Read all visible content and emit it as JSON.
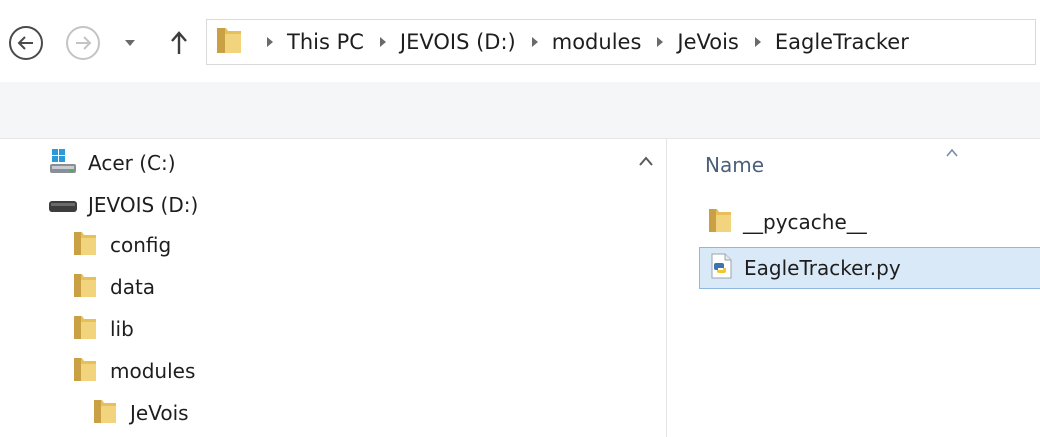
{
  "address_bar": {
    "path": [
      "This PC",
      "JEVOIS (D:)",
      "modules",
      "JeVois",
      "EagleTracker"
    ],
    "icons": {
      "back": "back-arrow-icon",
      "forward": "forward-arrow-icon",
      "recent": "chevron-down-icon",
      "up": "up-arrow-icon",
      "location": "folder-icon",
      "separator": "breadcrumb-arrow-icon"
    }
  },
  "nav_pane": {
    "items": [
      {
        "label": "Acer (C:)",
        "icon": "windows-drive-icon"
      },
      {
        "label": "JEVOIS (D:)",
        "icon": "removable-drive-icon"
      },
      {
        "label": "config",
        "icon": "folder-icon"
      },
      {
        "label": "data",
        "icon": "folder-icon"
      },
      {
        "label": "lib",
        "icon": "folder-icon"
      },
      {
        "label": "modules",
        "icon": "folder-icon"
      },
      {
        "label": "JeVois",
        "icon": "folder-icon"
      }
    ]
  },
  "file_list": {
    "column_header": "Name",
    "sort": "ascending",
    "items": [
      {
        "label": "__pycache__",
        "icon": "folder-icon",
        "selected": false
      },
      {
        "label": "EagleTracker.py",
        "icon": "python-file-icon",
        "selected": true
      }
    ]
  },
  "colors": {
    "selection_fill": "#d9e9f8",
    "selection_border": "#8fb8e0",
    "header_text": "#4c607a",
    "folder_yellow": "#e8c05a"
  }
}
